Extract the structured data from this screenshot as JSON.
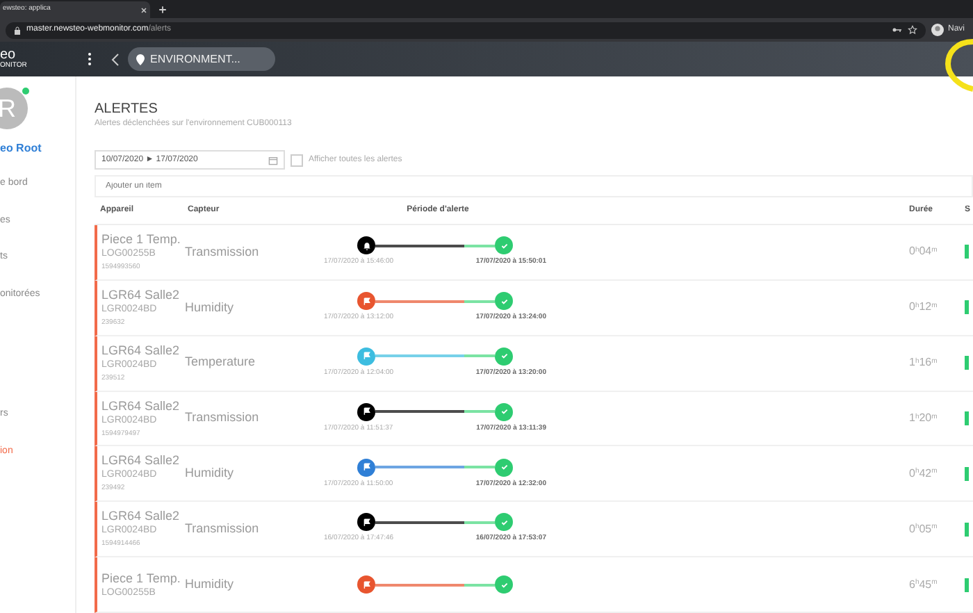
{
  "browser": {
    "tab_title": "ewsteo: applica",
    "url_host": "master.newsteo-webmonitor.com",
    "url_path": "/alerts",
    "profile": "Navi"
  },
  "header": {
    "logo": "eo",
    "logo_sub": "ONITOR",
    "environment": "ENVIRONMENT..."
  },
  "sidebar": {
    "avatar": "R",
    "online": true,
    "user": "eo Root",
    "items": [
      {
        "label": "e bord",
        "selected": false
      },
      {
        "label": "es",
        "selected": false
      },
      {
        "label": "ts",
        "selected": false
      },
      {
        "label": "onitorées",
        "selected": false
      },
      {
        "label": "rs",
        "selected": false
      },
      {
        "label": "ion",
        "selected": true
      }
    ]
  },
  "page": {
    "title": "ALERTES",
    "subtitle": "Alertes déclenchées sur l'environnement CUB000113",
    "date_range": "10/07/2020 ► 17/07/2020",
    "show_all": {
      "label": "Afficher toutes les alertes",
      "checked": false
    },
    "add_item": {
      "placeholder": "Ajouter un item"
    }
  },
  "table": {
    "columns": [
      "Appareil",
      "Capteur",
      "Période d'alerte",
      "Durée",
      "S"
    ],
    "rows": [
      {
        "device": "Piece 1 Temp.",
        "code": "LOG00255B",
        "id": "1594993560",
        "sensor": "Transmission",
        "kind": "bell",
        "color": "#000000",
        "start": "17/07/2020 à 15:46:00",
        "end": "17/07/2020 à 15:50:01",
        "duration": "0$^{h}$04$^{m}$"
      },
      {
        "device": "LGR64 Salle2",
        "code": "LGR0024BD",
        "id": "239632",
        "sensor": "Humidity",
        "kind": "flag",
        "color": "#e8552f",
        "start": "17/07/2020 à 13:12:00",
        "end": "17/07/2020 à 13:24:00",
        "duration": "0$^{h}$12$^{m}$"
      },
      {
        "device": "LGR64 Salle2",
        "code": "LGR0024BD",
        "id": "239512",
        "sensor": "Temperature",
        "kind": "flag",
        "color": "#3dbde0",
        "start": "17/07/2020 à 12:04:00",
        "end": "17/07/2020 à 13:20:00",
        "duration": "1$^{h}$16$^{m}$"
      },
      {
        "device": "LGR64 Salle2",
        "code": "LGR0024BD",
        "id": "1594979497",
        "sensor": "Transmission",
        "kind": "flag",
        "color": "#000000",
        "start": "17/07/2020 à 11:51:37",
        "end": "17/07/2020 à 13:11:39",
        "duration": "1$^{h}$20$^{m}$"
      },
      {
        "device": "LGR64 Salle2",
        "code": "LGR0024BD",
        "id": "239492",
        "sensor": "Humidity",
        "kind": "flag",
        "color": "#2f7fd6",
        "start": "17/07/2020 à 11:50:00",
        "end": "17/07/2020 à 12:32:00",
        "duration": "0$^{h}$42$^{m}$"
      },
      {
        "device": "LGR64 Salle2",
        "code": "LGR0024BD",
        "id": "1594914466",
        "sensor": "Transmission",
        "kind": "flag",
        "color": "#000000",
        "start": "16/07/2020 à 17:47:46",
        "end": "16/07/2020 à 17:53:07",
        "duration": "0$^{h}$05$^{m}$"
      },
      {
        "device": "Piece 1 Temp.",
        "code": "LOG00255B",
        "sensor": "Humidity",
        "kind": "flag",
        "color": "#e8552f",
        "duration": "6$^{h}$45$^{m}$"
      }
    ]
  }
}
